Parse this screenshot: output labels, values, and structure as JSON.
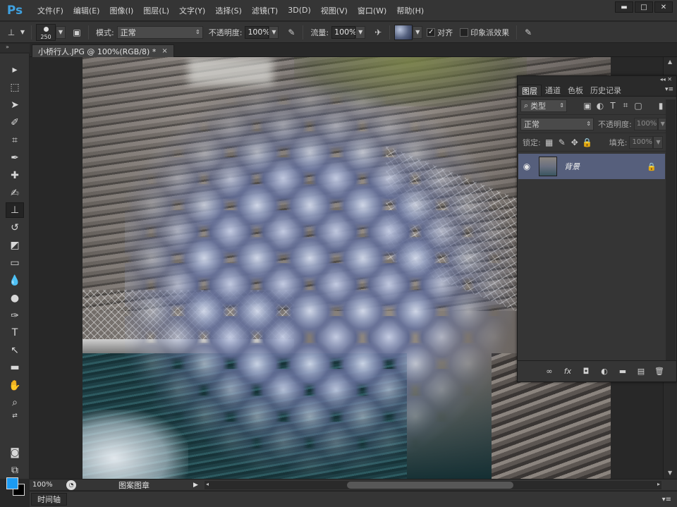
{
  "app": {
    "logo": "Ps"
  },
  "menu": [
    "文件(F)",
    "编辑(E)",
    "图像(I)",
    "图层(L)",
    "文字(Y)",
    "选择(S)",
    "滤镜(T)",
    "3D(D)",
    "视图(V)",
    "窗口(W)",
    "帮助(H)"
  ],
  "window_controls": {
    "minimize": "▬",
    "maximize": "□",
    "close": "✕"
  },
  "options": {
    "brush_size": "250",
    "mode_label": "模式:",
    "mode_value": "正常",
    "opacity_label": "不透明度:",
    "opacity_value": "100%",
    "flow_label": "流量:",
    "flow_value": "100%",
    "align_label": "对齐",
    "align_checked": true,
    "impressionist_label": "印象派效果",
    "impressionist_checked": false
  },
  "document": {
    "tab_title": "小桥行人.JPG @ 100%(RGB/8) *",
    "tab_close": "×"
  },
  "status": {
    "zoom": "100%",
    "info": "图案图章"
  },
  "timeline": {
    "tab": "时间轴"
  },
  "colors": {
    "foreground": "#1c9bf2",
    "background": "#000000",
    "layer_selected": "#565f7c"
  },
  "layers_panel": {
    "tabs": [
      "图层",
      "通道",
      "色板",
      "历史记录"
    ],
    "filter_label": "类型",
    "blend_mode": "正常",
    "opacity_label": "不透明度:",
    "opacity_value": "100%",
    "lock_label": "锁定:",
    "fill_label": "填充:",
    "fill_value": "100%",
    "layers": [
      {
        "name": "背景",
        "visible": true,
        "locked": true
      }
    ]
  }
}
